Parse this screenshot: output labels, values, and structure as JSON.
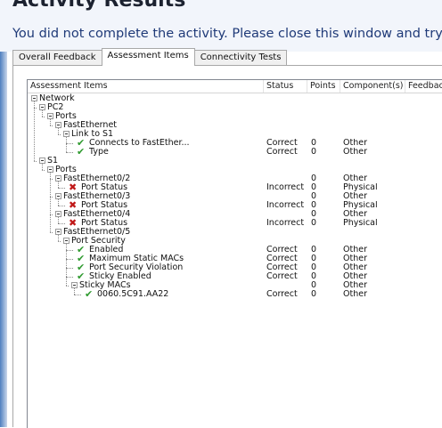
{
  "title": "Activity Results",
  "message": "You did not complete the activity. Please close this window and try again.",
  "tabs": [
    {
      "label": "Overall Feedback",
      "active": false
    },
    {
      "label": "Assessment Items",
      "active": true
    },
    {
      "label": "Connectivity Tests",
      "active": false
    }
  ],
  "columns": [
    "Assessment Items",
    "Status",
    "Points",
    "Component(s)",
    "Feedback"
  ],
  "rows": [
    {
      "depth": 0,
      "label": "Network",
      "icon": "",
      "status": "",
      "points": "",
      "component": ""
    },
    {
      "depth": 1,
      "label": "PC2",
      "icon": "",
      "status": "",
      "points": "",
      "component": ""
    },
    {
      "depth": 2,
      "label": "Ports",
      "icon": "",
      "status": "",
      "points": "",
      "component": ""
    },
    {
      "depth": 3,
      "label": "FastEthernet",
      "icon": "",
      "status": "",
      "points": "",
      "component": ""
    },
    {
      "depth": 4,
      "label": "Link to S1",
      "icon": "",
      "status": "",
      "points": "",
      "component": ""
    },
    {
      "depth": 5,
      "label": "Connects to FastEther...",
      "icon": "check",
      "status": "Correct",
      "points": "0",
      "component": "Other"
    },
    {
      "depth": 5,
      "label": "Type",
      "icon": "check",
      "status": "Correct",
      "points": "0",
      "component": "Other"
    },
    {
      "depth": 1,
      "label": "S1",
      "icon": "",
      "status": "",
      "points": "",
      "component": ""
    },
    {
      "depth": 2,
      "label": "Ports",
      "icon": "",
      "status": "",
      "points": "",
      "component": ""
    },
    {
      "depth": 3,
      "label": "FastEthernet0/2",
      "icon": "",
      "status": "",
      "points": "0",
      "component": "Other"
    },
    {
      "depth": 4,
      "label": "Port Status",
      "icon": "cross",
      "status": "Incorrect",
      "points": "0",
      "component": "Physical"
    },
    {
      "depth": 3,
      "label": "FastEthernet0/3",
      "icon": "",
      "status": "",
      "points": "0",
      "component": "Other"
    },
    {
      "depth": 4,
      "label": "Port Status",
      "icon": "cross",
      "status": "Incorrect",
      "points": "0",
      "component": "Physical"
    },
    {
      "depth": 3,
      "label": "FastEthernet0/4",
      "icon": "",
      "status": "",
      "points": "0",
      "component": "Other"
    },
    {
      "depth": 4,
      "label": "Port Status",
      "icon": "cross",
      "status": "Incorrect",
      "points": "0",
      "component": "Physical"
    },
    {
      "depth": 3,
      "label": "FastEthernet0/5",
      "icon": "",
      "status": "",
      "points": "",
      "component": ""
    },
    {
      "depth": 4,
      "label": "Port Security",
      "icon": "",
      "status": "",
      "points": "",
      "component": ""
    },
    {
      "depth": 5,
      "label": "Enabled",
      "icon": "check",
      "status": "Correct",
      "points": "0",
      "component": "Other"
    },
    {
      "depth": 5,
      "label": "Maximum Static MACs",
      "icon": "check",
      "status": "Correct",
      "points": "0",
      "component": "Other"
    },
    {
      "depth": 5,
      "label": "Port Security Violation",
      "icon": "check",
      "status": "Correct",
      "points": "0",
      "component": "Other"
    },
    {
      "depth": 5,
      "label": "Sticky Enabled",
      "icon": "check",
      "status": "Correct",
      "points": "0",
      "component": "Other"
    },
    {
      "depth": 5,
      "label": "Sticky MACs",
      "icon": "",
      "status": "",
      "points": "0",
      "component": "Other"
    },
    {
      "depth": 6,
      "label": "0060.5C91.AA22",
      "icon": "check",
      "status": "Correct",
      "points": "0",
      "component": "Other"
    }
  ],
  "colors": {
    "correct": "#2f9a2f",
    "incorrect": "#c01818",
    "message": "#1f3a78"
  },
  "icons": {
    "check": "check-icon",
    "cross": "cross-icon",
    "expander": "collapse-toggle-icon"
  }
}
